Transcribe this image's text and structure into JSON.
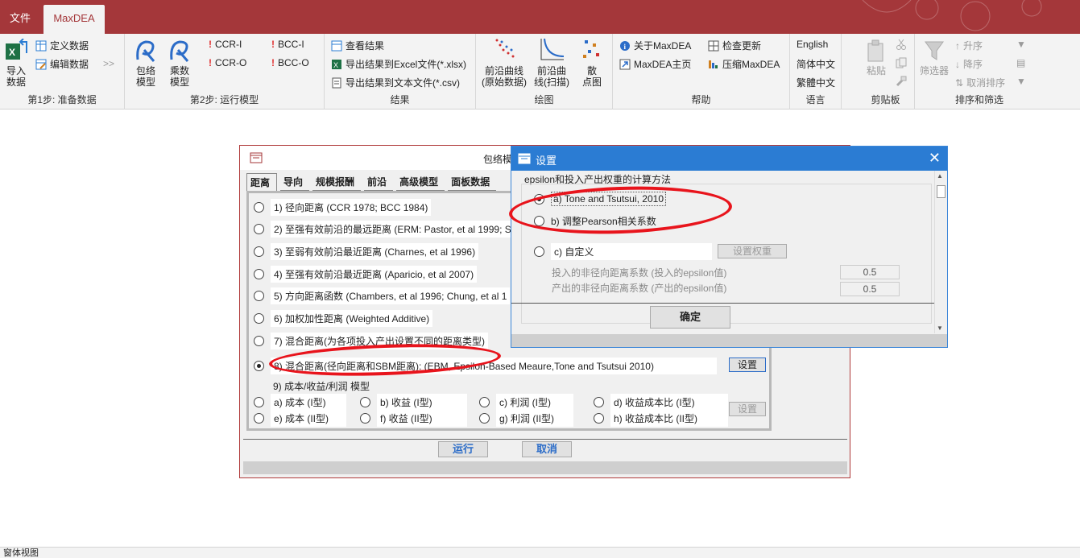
{
  "tabs": {
    "file": "文件",
    "active": "MaxDEA"
  },
  "ribbon": {
    "groups": {
      "prepare": "第1步: 准备数据",
      "run": "第2步: 运行模型",
      "results": "结果",
      "plot": "绘图",
      "help": "帮助",
      "language": "语言",
      "clipboard": "剪贴板",
      "sortfilter": "排序和筛选"
    },
    "import_data": "导入\n数据",
    "define_data": "定义数据",
    "edit_data": "编辑数据",
    "arrow": ">>",
    "envelope_model": "包络\n模型",
    "multiplier_model": "乘数\n模型",
    "ccr_i": "CCR-I",
    "ccr_o": "CCR-O",
    "bcc_i": "BCC-I",
    "bcc_o": "BCC-O",
    "view_results": "查看结果",
    "export_excel": "导出结果到Excel文件(*.xlsx)",
    "export_text": "导出结果到文本文件(*.csv)",
    "frontier_raw": "前沿曲线\n(原始数据)",
    "frontier_scan": "前沿曲\n线(扫描)",
    "scatter": "散\n点图",
    "about": "关于MaxDEA",
    "homepage": "MaxDEA主页",
    "check_update": "检查更新",
    "compress": "压缩MaxDEA",
    "english": "English",
    "simplified": "简体中文",
    "traditional": "繁體中文",
    "paste": "粘贴",
    "filter": "筛选器",
    "asc": "升序",
    "desc": "降序",
    "clear_sort": "取消排序"
  },
  "main_dialog": {
    "title": "包络模",
    "tabs": [
      "距离",
      "导向",
      "规模报酬",
      "前沿",
      "高级模型",
      "面板数据"
    ],
    "options": [
      "1) 径向距离 (CCR 1978; BCC 1984)",
      "2) 至强有效前沿的最远距离 (ERM: Pastor, et al 1999; S",
      "3) 至弱有效前沿最近距离 (Charnes, et al 1996)",
      "4) 至强有效前沿最近距离 (Aparicio, et al 2007)",
      "5) 方向距离函数 (Chambers, et al 1996; Chung, et al 1",
      "6) 加权加性距离 (Weighted Additive)",
      "7) 混合距离(为各项投入产出设置不同的距离类型)",
      "8) 混合距离(径向距离和SBM距离): (EBM, Epsilon-Based Meaure,Tone and Tsutsui 2010)"
    ],
    "selected_option": 8,
    "settings_button": "设置",
    "cost_heading": "9) 成本/收益/利润 模型",
    "cost_options": [
      "a) 成本 (I型)",
      "b) 收益 (I型)",
      "c) 利润 (I型)",
      "d) 收益成本比 (I型)",
      "e) 成本 (II型)",
      "f) 收益 (II型)",
      "g) 利润 (II型)",
      "h) 收益成本比 (II型)"
    ],
    "cost_settings_button": "设置",
    "run_button": "运行",
    "cancel_button": "取消"
  },
  "settings_dialog": {
    "title": "设置",
    "heading": "epsilon和投入产出权重的计算方法",
    "option_a": "a) Tone and Tsutsui, 2010",
    "option_b": "b) 调整Pearson相关系数",
    "option_c": "c) 自定义",
    "set_weights_button": "设置权重",
    "input_epsilon_label": "投入的非径向距离系数 (投入的epsilon值)",
    "input_epsilon_value": "0.5",
    "output_epsilon_label": "产出的非径向距离系数 (产出的epsilon值)",
    "output_epsilon_value": "0.5",
    "ok_button": "确定",
    "selected": "a"
  },
  "status": {
    "view": "窗体视图"
  },
  "colors": {
    "accent": "#a4373a",
    "title_blue": "#2b7cd3",
    "annotation": "#e8141c"
  }
}
